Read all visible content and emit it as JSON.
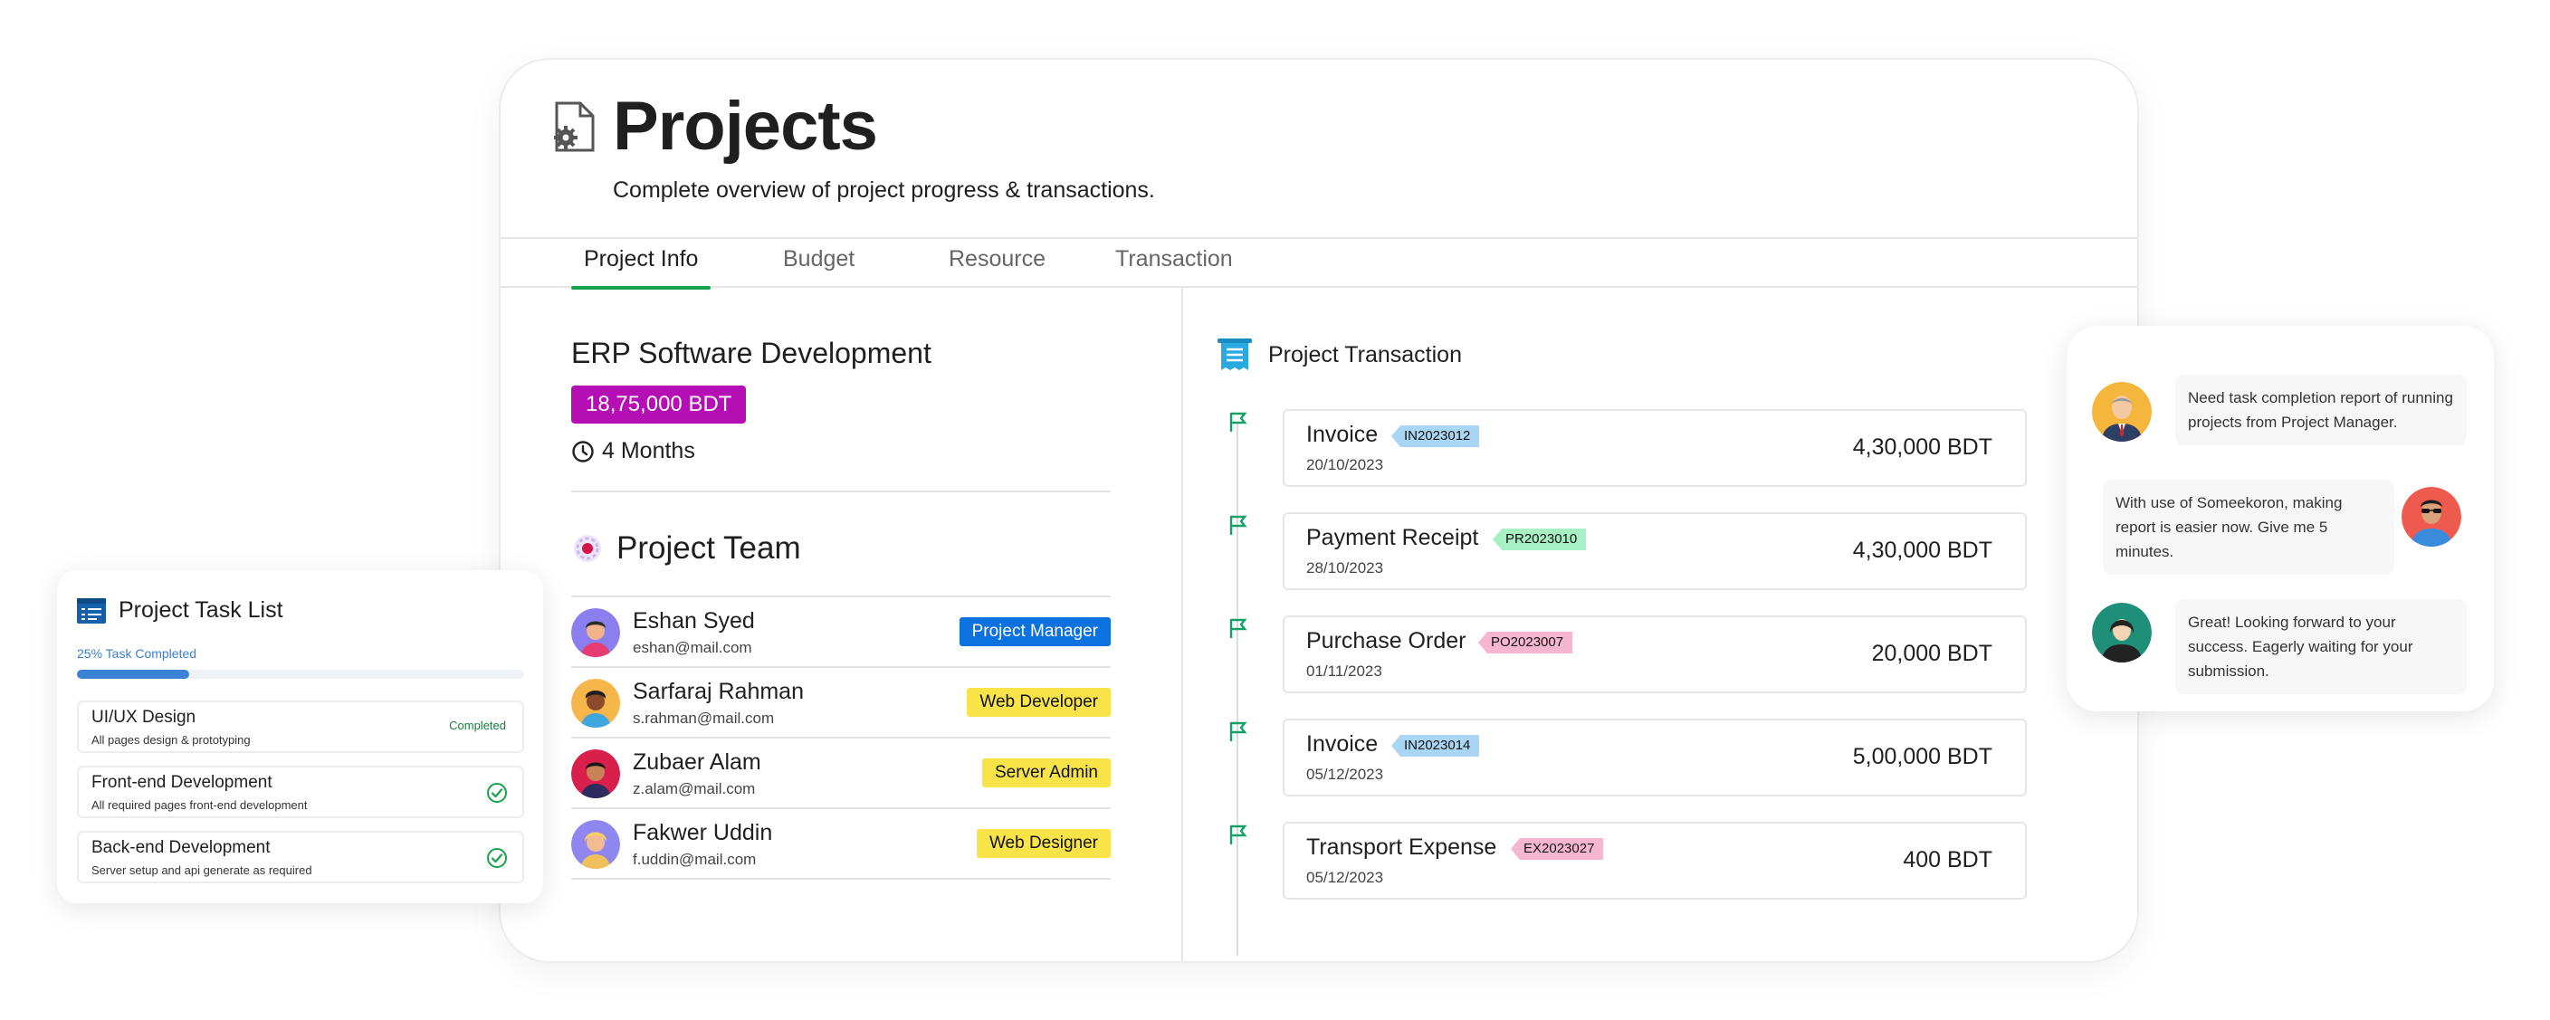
{
  "header": {
    "title": "Projects",
    "subtitle": "Complete overview of project progress & transactions."
  },
  "tabs": [
    {
      "label": "Project Info",
      "active": true
    },
    {
      "label": "Budget",
      "active": false
    },
    {
      "label": "Resource",
      "active": false
    },
    {
      "label": "Transaction",
      "active": false
    }
  ],
  "project": {
    "name": "ERP Software Development",
    "budget": "18,75,000 BDT",
    "duration": "4 Months"
  },
  "team": {
    "title": "Project Team",
    "members": [
      {
        "name": "Eshan Syed",
        "email": "eshan@mail.com",
        "role": "Project Manager",
        "role_color": "#0b72e0",
        "role_text_color": "#ffffff"
      },
      {
        "name": "Sarfaraj Rahman",
        "email": "s.rahman@mail.com",
        "role": "Web Developer",
        "role_color": "#f8e349",
        "role_text_color": "#111111"
      },
      {
        "name": "Zubaer Alam",
        "email": "z.alam@mail.com",
        "role": "Server Admin",
        "role_color": "#f8e349",
        "role_text_color": "#111111"
      },
      {
        "name": "Fakwer Uddin",
        "email": "f.uddin@mail.com",
        "role": "Web Designer",
        "role_color": "#f8e349",
        "role_text_color": "#111111"
      }
    ]
  },
  "transactions": {
    "title": "Project Transaction",
    "items": [
      {
        "type": "Invoice",
        "code": "IN2023012",
        "code_color": "#a9d6f5",
        "date": "20/10/2023",
        "amount": "4,30,000 BDT"
      },
      {
        "type": "Payment Receipt",
        "code": "PR2023010",
        "code_color": "#a7f0c3",
        "date": "28/10/2023",
        "amount": "4,30,000 BDT"
      },
      {
        "type": "Purchase Order",
        "code": "PO2023007",
        "code_color": "#f7b6cf",
        "date": "01/11/2023",
        "amount": "20,000 BDT"
      },
      {
        "type": "Invoice",
        "code": "IN2023014",
        "code_color": "#a9d6f5",
        "date": "05/12/2023",
        "amount": "5,00,000 BDT"
      },
      {
        "type": "Transport Expense",
        "code": "EX2023027",
        "code_color": "#f7b6cf",
        "date": "05/12/2023",
        "amount": "400 BDT"
      }
    ]
  },
  "task_list": {
    "title": "Project Task List",
    "progress_label": "25% Task Completed",
    "progress": 0.25,
    "tasks": [
      {
        "name": "UI/UX Design",
        "desc": "All pages design & prototyping",
        "status": "Completed"
      },
      {
        "name": "Front-end Development",
        "desc": "All required pages front-end development",
        "status": "check"
      },
      {
        "name": "Back-end Development",
        "desc": "Server setup and api generate as required",
        "status": "check"
      }
    ]
  },
  "chat": {
    "messages": [
      {
        "text": "Need task completion report of running projects from Project Manager.",
        "avatar": "manager-avatar"
      },
      {
        "text": "With use of Someekoron, making report is easier now. Give me 5 minutes.",
        "avatar": "developer-avatar"
      },
      {
        "text": "Great! Looking forward to your success. Eagerly waiting for your submission.",
        "avatar": "client-avatar"
      }
    ]
  },
  "colors": {
    "accent": "#16a34a",
    "budget_badge": "#b40eb4",
    "progress": "#3b82d6"
  }
}
